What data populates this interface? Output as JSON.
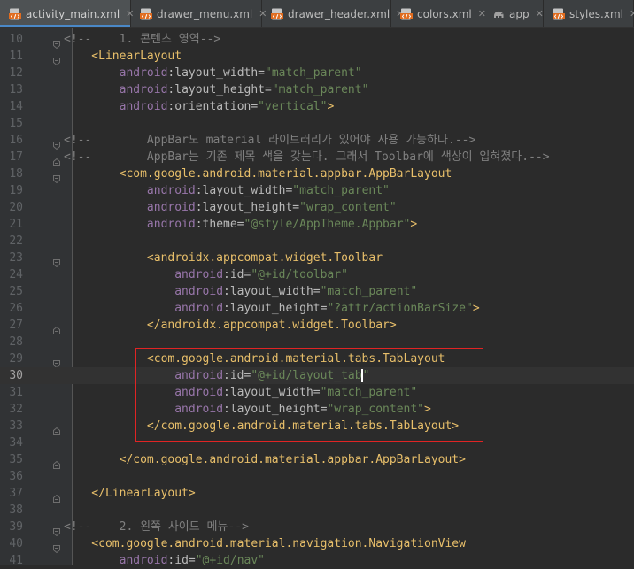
{
  "tabs": [
    {
      "label": "activity_main.xml",
      "icon": "xml-file-icon",
      "active": true
    },
    {
      "label": "drawer_menu.xml",
      "icon": "xml-file-icon",
      "active": false
    },
    {
      "label": "drawer_header.xml",
      "icon": "xml-file-icon",
      "active": false
    },
    {
      "label": "colors.xml",
      "icon": "xml-file-icon",
      "active": false
    },
    {
      "label": "app",
      "icon": "gradle-elephant-icon",
      "active": false
    },
    {
      "label": "styles.xml",
      "icon": "xml-file-icon",
      "active": false
    }
  ],
  "close_glyph": "✕",
  "current_line": "30",
  "colors": {
    "background": "#2b2b2b",
    "gutter": "#313335",
    "tag": "#e8bf6a",
    "namespace": "#9876aa",
    "attribute": "#bababa",
    "string": "#6a8759",
    "comment": "#808080",
    "highlight_box": "#e02424"
  },
  "editor": {
    "lines": [
      {
        "num": "10",
        "fold": "open",
        "tokens": [
          {
            "t": "<!--    1. 콘텐츠 영역-->",
            "k": "comment"
          }
        ]
      },
      {
        "num": "11",
        "fold": "open",
        "tokens": [
          {
            "t": "    <",
            "k": "tag"
          },
          {
            "t": "LinearLayout",
            "k": "tag"
          }
        ]
      },
      {
        "num": "12",
        "fold": "",
        "tokens": [
          {
            "t": "        ",
            "k": "plain"
          },
          {
            "t": "android",
            "k": "ns"
          },
          {
            "t": ":layout_width=",
            "k": "attr"
          },
          {
            "t": "\"match_parent\"",
            "k": "str"
          }
        ]
      },
      {
        "num": "13",
        "fold": "",
        "tokens": [
          {
            "t": "        ",
            "k": "plain"
          },
          {
            "t": "android",
            "k": "ns"
          },
          {
            "t": ":layout_height=",
            "k": "attr"
          },
          {
            "t": "\"match_parent\"",
            "k": "str"
          }
        ]
      },
      {
        "num": "14",
        "fold": "",
        "tokens": [
          {
            "t": "        ",
            "k": "plain"
          },
          {
            "t": "android",
            "k": "ns"
          },
          {
            "t": ":orientation=",
            "k": "attr"
          },
          {
            "t": "\"vertical\"",
            "k": "str"
          },
          {
            "t": ">",
            "k": "tag"
          }
        ]
      },
      {
        "num": "15",
        "fold": "",
        "tokens": []
      },
      {
        "num": "16",
        "fold": "open",
        "tokens": [
          {
            "t": "<!--        AppBar도 material 라이브러리가 있어야 사용 가능하다.-->",
            "k": "comment"
          }
        ]
      },
      {
        "num": "17",
        "fold": "close",
        "tokens": [
          {
            "t": "<!--        AppBar는 기존 제목 색을 갖는다. 그래서 Toolbar에 색상이 입혀졌다.-->",
            "k": "comment"
          }
        ]
      },
      {
        "num": "18",
        "fold": "open",
        "tokens": [
          {
            "t": "        <com.google.android.material.appbar.AppBarLayout",
            "k": "tag"
          }
        ]
      },
      {
        "num": "19",
        "fold": "",
        "tokens": [
          {
            "t": "            ",
            "k": "plain"
          },
          {
            "t": "android",
            "k": "ns"
          },
          {
            "t": ":layout_width=",
            "k": "attr"
          },
          {
            "t": "\"match_parent\"",
            "k": "str"
          }
        ]
      },
      {
        "num": "20",
        "fold": "",
        "tokens": [
          {
            "t": "            ",
            "k": "plain"
          },
          {
            "t": "android",
            "k": "ns"
          },
          {
            "t": ":layout_height=",
            "k": "attr"
          },
          {
            "t": "\"wrap_content\"",
            "k": "str"
          }
        ]
      },
      {
        "num": "21",
        "fold": "",
        "tokens": [
          {
            "t": "            ",
            "k": "plain"
          },
          {
            "t": "android",
            "k": "ns"
          },
          {
            "t": ":theme=",
            "k": "attr"
          },
          {
            "t": "\"@style/AppTheme.Appbar\"",
            "k": "str"
          },
          {
            "t": ">",
            "k": "tag"
          }
        ]
      },
      {
        "num": "22",
        "fold": "",
        "tokens": []
      },
      {
        "num": "23",
        "fold": "open",
        "tokens": [
          {
            "t": "            <androidx.appcompat.widget.Toolbar",
            "k": "tag"
          }
        ]
      },
      {
        "num": "24",
        "fold": "",
        "tokens": [
          {
            "t": "                ",
            "k": "plain"
          },
          {
            "t": "android",
            "k": "ns"
          },
          {
            "t": ":id=",
            "k": "attr"
          },
          {
            "t": "\"@+id/toolbar\"",
            "k": "str"
          }
        ]
      },
      {
        "num": "25",
        "fold": "",
        "tokens": [
          {
            "t": "                ",
            "k": "plain"
          },
          {
            "t": "android",
            "k": "ns"
          },
          {
            "t": ":layout_width=",
            "k": "attr"
          },
          {
            "t": "\"match_parent\"",
            "k": "str"
          }
        ]
      },
      {
        "num": "26",
        "fold": "",
        "tokens": [
          {
            "t": "                ",
            "k": "plain"
          },
          {
            "t": "android",
            "k": "ns"
          },
          {
            "t": ":layout_height=",
            "k": "attr"
          },
          {
            "t": "\"?attr/actionBarSize\"",
            "k": "str"
          },
          {
            "t": ">",
            "k": "tag"
          }
        ]
      },
      {
        "num": "27",
        "fold": "close",
        "tokens": [
          {
            "t": "            </androidx.appcompat.widget.Toolbar>",
            "k": "tag"
          }
        ]
      },
      {
        "num": "28",
        "fold": "",
        "tokens": []
      },
      {
        "num": "29",
        "fold": "open",
        "tokens": [
          {
            "t": "            <com.google.android.material.tabs.TabLayout",
            "k": "tag"
          }
        ]
      },
      {
        "num": "30",
        "fold": "",
        "tokens": [
          {
            "t": "                ",
            "k": "plain"
          },
          {
            "t": "android",
            "k": "ns"
          },
          {
            "t": ":id=",
            "k": "attr"
          },
          {
            "t": "\"@+id/layout_tab",
            "k": "str"
          },
          {
            "t": "|",
            "k": "cursor"
          },
          {
            "t": "\"",
            "k": "str"
          }
        ]
      },
      {
        "num": "31",
        "fold": "",
        "tokens": [
          {
            "t": "                ",
            "k": "plain"
          },
          {
            "t": "android",
            "k": "ns"
          },
          {
            "t": ":layout_width=",
            "k": "attr"
          },
          {
            "t": "\"match_parent\"",
            "k": "str"
          }
        ]
      },
      {
        "num": "32",
        "fold": "",
        "tokens": [
          {
            "t": "                ",
            "k": "plain"
          },
          {
            "t": "android",
            "k": "ns"
          },
          {
            "t": ":layout_height=",
            "k": "attr"
          },
          {
            "t": "\"wrap_content\"",
            "k": "str"
          },
          {
            "t": ">",
            "k": "tag"
          }
        ]
      },
      {
        "num": "33",
        "fold": "close",
        "tokens": [
          {
            "t": "            </com.google.android.material.tabs.TabLayout>",
            "k": "tag"
          }
        ]
      },
      {
        "num": "34",
        "fold": "",
        "tokens": []
      },
      {
        "num": "35",
        "fold": "close",
        "tokens": [
          {
            "t": "        </com.google.android.material.appbar.AppBarLayout>",
            "k": "tag"
          }
        ]
      },
      {
        "num": "36",
        "fold": "",
        "tokens": []
      },
      {
        "num": "37",
        "fold": "close",
        "tokens": [
          {
            "t": "    </LinearLayout>",
            "k": "tag"
          }
        ]
      },
      {
        "num": "38",
        "fold": "",
        "tokens": []
      },
      {
        "num": "39",
        "fold": "open",
        "tokens": [
          {
            "t": "<!--    2. 왼쪽 사이드 메뉴-->",
            "k": "comment"
          }
        ]
      },
      {
        "num": "40",
        "fold": "open",
        "tokens": [
          {
            "t": "    <com.google.android.material.navigation.NavigationView",
            "k": "tag"
          }
        ]
      },
      {
        "num": "41",
        "fold": "",
        "tokens": [
          {
            "t": "        ",
            "k": "plain"
          },
          {
            "t": "android",
            "k": "ns"
          },
          {
            "t": ":id=",
            "k": "attr"
          },
          {
            "t": "\"@+id/nav\"",
            "k": "str"
          }
        ]
      }
    ]
  }
}
